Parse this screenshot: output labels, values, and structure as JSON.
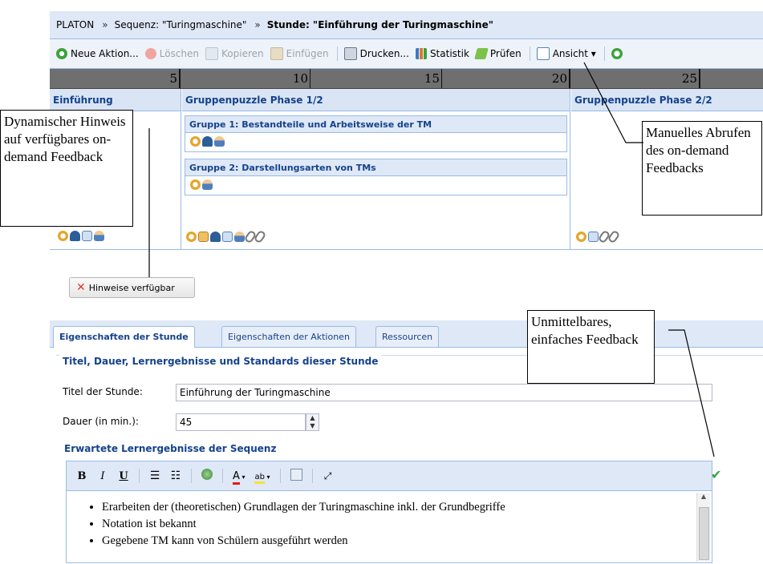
{
  "breadcrumb": {
    "root": "PLATON",
    "sep": "»",
    "sequence": "Sequenz: \"Turingmaschine\"",
    "current": "Stunde: \"Einführung der Turingmaschine\""
  },
  "toolbar": {
    "new_action": "Neue Aktion...",
    "delete": "Löschen",
    "copy": "Kopieren",
    "paste": "Einfügen",
    "print": "Drucken...",
    "statistics": "Statistik",
    "check": "Prüfen",
    "view": "Ansicht ▾"
  },
  "ruler": {
    "ticks": [
      "5",
      "10",
      "15",
      "20",
      "25"
    ]
  },
  "timeline": {
    "phases": [
      "Einführung",
      "Gruppenpuzzle Phase 1/2",
      "Gruppenpuzzle Phase 2/2"
    ],
    "groups": [
      "Gruppe 1: Bestandteile und Arbeitsweise der TM",
      "Gruppe 2: Darstellungsarten von TMs"
    ],
    "hint_button": "Hinweise verfügbar"
  },
  "tabs": [
    "Eigenschaften der Stunde",
    "Eigenschaften der Aktionen",
    "Ressourcen"
  ],
  "form": {
    "legend": "Titel, Dauer, Lernergebnisse und Standards dieser Stunde",
    "title_label": "Titel der Stunde:",
    "title_value": "Einführung der Turingmaschine",
    "duration_label": "Dauer (in min.):",
    "duration_value": "45",
    "outcomes_heading": "Erwartete Lernergebnisse der Sequenz"
  },
  "editor": {
    "toolbar": {
      "bold": "B",
      "italic": "I",
      "underline": "U",
      "font_color": "A",
      "highlight": "ab"
    },
    "items": [
      "Erarbeiten der (theoretischen) Grundlagen der Turingmaschine inkl. der Grundbegriffe",
      "Notation ist bekannt",
      "Gegebene TM kann von Schülern ausgeführt werden"
    ]
  },
  "annotations": {
    "dynamic_hint": "Dynamischer Hinweis auf verfügbares on-demand Feedback",
    "manual_fetch": "Manuelles Abrufen des on-demand Feedbacks",
    "immediate": "Unmittelbares, einfaches Feedback"
  },
  "colors": {
    "header_bg": "#dfe8f6",
    "accent": "#15428b",
    "border": "#99bbe8",
    "ruler": "#6f6f6f"
  }
}
